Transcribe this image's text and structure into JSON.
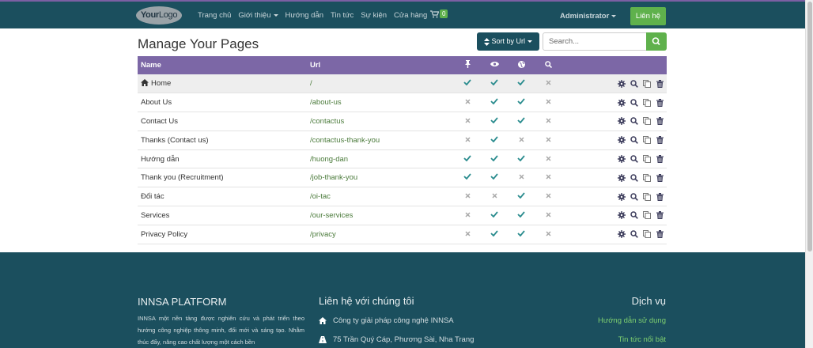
{
  "navbar": {
    "logo_bold": "Your",
    "logo_thin": "Logo",
    "items": [
      {
        "label": "Trang chủ",
        "dropdown": false
      },
      {
        "label": "Giới thiệu",
        "dropdown": true
      },
      {
        "label": "Hướng dẫn",
        "dropdown": false
      },
      {
        "label": "Tin tức",
        "dropdown": false
      },
      {
        "label": "Sự kiện",
        "dropdown": false
      },
      {
        "label": "Cửa hàng",
        "dropdown": false
      }
    ],
    "cart_count": "0",
    "user": "Administrator",
    "contact_button": "Liên hệ"
  },
  "main": {
    "title": "Manage Your Pages",
    "sort_button": "Sort by Url",
    "search_placeholder": "Search..."
  },
  "table": {
    "headers": {
      "name": "Name",
      "url": "Url"
    },
    "header_icons": [
      "pin-icon",
      "eye-icon",
      "globe-icon",
      "search-icon"
    ],
    "rows": [
      {
        "name": "Home",
        "url": "/",
        "home": true,
        "pinned": true,
        "visible": true,
        "published": true,
        "indexed": false
      },
      {
        "name": "About Us",
        "url": "/about-us",
        "pinned": false,
        "visible": true,
        "published": true,
        "indexed": false
      },
      {
        "name": "Contact Us",
        "url": "/contactus",
        "pinned": false,
        "visible": true,
        "published": true,
        "indexed": false
      },
      {
        "name": "Thanks (Contact us)",
        "url": "/contactus-thank-you",
        "pinned": false,
        "visible": true,
        "published": false,
        "indexed": false
      },
      {
        "name": "Hướng dẫn",
        "url": "/huong-dan",
        "pinned": true,
        "visible": true,
        "published": true,
        "indexed": false
      },
      {
        "name": "Thank you (Recruitment)",
        "url": "/job-thank-you",
        "pinned": true,
        "visible": true,
        "published": false,
        "indexed": false
      },
      {
        "name": "Đối tác",
        "url": "/oi-tac",
        "pinned": false,
        "visible": false,
        "published": true,
        "indexed": false
      },
      {
        "name": "Services",
        "url": "/our-services",
        "pinned": false,
        "visible": true,
        "published": true,
        "indexed": false
      },
      {
        "name": "Privacy Policy",
        "url": "/privacy",
        "pinned": false,
        "visible": true,
        "published": true,
        "indexed": false
      }
    ],
    "row_action_icons": [
      "gear-icon",
      "search-icon",
      "copy-icon",
      "trash-icon"
    ]
  },
  "footer": {
    "col1_title": "INNSA PLATFORM",
    "col1_text": "INNSA một nền tảng được nghiên cứu và phát triển theo hướng công nghiệp thông minh, đổi mới và sáng tạo. Nhằm thúc đẩy, nâng cao chất lượng một cách bền",
    "col2_title": "Liên hệ với chúng tôi",
    "col2_company": "Công  ty giải pháp công nghệ INNSA",
    "col2_address": "75 Trần Quý Cáp, Phương Sài, Nha Trang",
    "col3_title": "Dịch vụ",
    "col3_link1": "Hướng dẫn sử dụng",
    "col3_link2": "Tin tức nổi bật"
  },
  "colors": {
    "navbar": "#1b4f5e",
    "table_header": "#7c67a6",
    "accent_green": "#5fb14c",
    "check_teal": "#2a8c8e"
  }
}
